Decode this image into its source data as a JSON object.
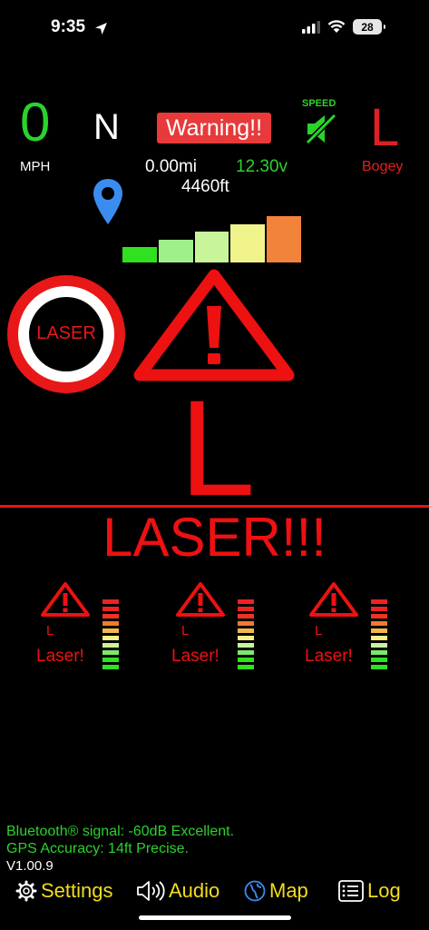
{
  "status_bar": {
    "time": "9:35",
    "battery": "28"
  },
  "dashboard": {
    "speed_value": "0",
    "speed_unit": "MPH",
    "heading": "N",
    "warning_label": "Warning!!",
    "distance": "0.00mi",
    "voltage": "12.30v",
    "altitude": "4460ft",
    "speed_label": "SPEED",
    "band_letter": "L",
    "band_type": "Bogey"
  },
  "signal_meter": {
    "levels": 5,
    "active": 5,
    "colors": [
      "#2fe11f",
      "#9ff08a",
      "#c9f59a",
      "#f1f48a",
      "#f2833a"
    ]
  },
  "alert": {
    "badge_text": "LASER",
    "band_letter": "L",
    "headline": "LASER!!!"
  },
  "slots": [
    {
      "letter": "L",
      "label": "Laser!"
    },
    {
      "letter": "L",
      "label": "Laser!"
    },
    {
      "letter": "L",
      "label": "Laser!"
    }
  ],
  "footer": {
    "bluetooth_signal": "Bluetooth® signal: -60dB Excellent.",
    "gps_accuracy": "GPS Accuracy: 14ft Precise.",
    "version": "V1.00.9"
  },
  "nav": {
    "settings": "Settings",
    "audio": "Audio",
    "map": "Map",
    "log": "Log"
  },
  "colors": {
    "accent_green": "#2bd22b",
    "alert_red": "#ee1111",
    "nav_yellow": "#f2dd1f",
    "map_blue": "#3b8cf0"
  },
  "icons": {
    "location": "location-pin-icon",
    "speed_mute": "speaker-muted-icon",
    "warning": "warning-triangle-icon",
    "settings": "gear-icon",
    "audio": "speaker-icon",
    "map": "globe-icon",
    "log": "list-icon"
  }
}
